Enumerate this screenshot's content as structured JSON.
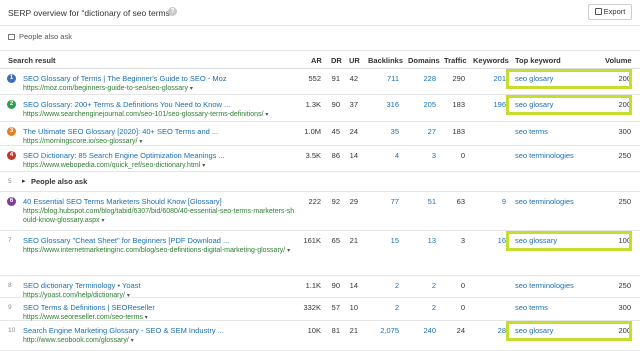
{
  "header": {
    "title": "SERP overview for “dictionary of seo terms”",
    "help_icon": "?",
    "export_label": "Export",
    "people_also_ask_label": "People also ask"
  },
  "columns": {
    "result": "Search result",
    "ar": "AR",
    "dr": "DR",
    "ur": "UR",
    "backlinks": "Backlinks",
    "domains": "Domains",
    "traffic": "Traffic",
    "keywords": "Keywords",
    "top_keyword": "Top keyword",
    "volume": "Volume"
  },
  "colors": {
    "highlight": "#c6dc2f",
    "link": "#1a6fb5",
    "url": "#2e7d32"
  },
  "rows": [
    {
      "rank": "1",
      "badge_color": "#3b6fb6",
      "title": "SEO Glossary of Terms | The Beginner's Guide to SEO - Moz",
      "url": "https://moz.com/beginners-guide-to-seo/seo-glossary",
      "ar": "552",
      "dr": "91",
      "ur": "42",
      "backlinks": "711",
      "domains": "228",
      "traffic": "290",
      "keywords": "201",
      "top_keyword": "seo glosary",
      "volume": "200",
      "highlight": true
    },
    {
      "rank": "2",
      "badge_color": "#2e9d4c",
      "title": "SEO Glossary: 200+ Terms & Definitions You Need to Know ...",
      "url": "https://www.searchenginejournal.com/seo-101/seo-glossary-terms-definitions/",
      "ar": "1.3K",
      "dr": "90",
      "ur": "37",
      "backlinks": "316",
      "domains": "205",
      "traffic": "183",
      "keywords": "196",
      "top_keyword": "seo glosary",
      "volume": "200",
      "highlight": true
    },
    {
      "rank": "3",
      "badge_color": "#e67e22",
      "title": "The Ultimate SEO Glossary [2020]: 40+ SEO Terms and ...",
      "url": "https://morningscore.io/seo-glossary/",
      "ar": "1.0M",
      "dr": "45",
      "ur": "24",
      "backlinks": "35",
      "domains": "27",
      "traffic": "183",
      "keywords": "",
      "top_keyword": "seo terms",
      "volume": "300",
      "highlight": false
    },
    {
      "rank": "4",
      "badge_color": "#c0392b",
      "title": "SEO Dictionary: 85 Search Engine Optimization Meanings ...",
      "url": "https://www.webopedia.com/quick_ref/seo-dictionary.html",
      "ar": "3.5K",
      "dr": "86",
      "ur": "14",
      "backlinks": "4",
      "domains": "3",
      "traffic": "0",
      "keywords": "",
      "top_keyword": "seo terminologies",
      "volume": "250",
      "highlight": false
    },
    {
      "rank": "6",
      "badge_color": "#7d3c98",
      "title": "40 Essential SEO Terms Marketers Should Know [Glossary]",
      "url": "https://blog.hubspot.com/blog/tabid/6307/bid/6080/40-essential-seo-terms-marketers-should-know-glossary.aspx",
      "ar": "222",
      "dr": "92",
      "ur": "29",
      "backlinks": "77",
      "domains": "51",
      "traffic": "63",
      "keywords": "9",
      "top_keyword": "seo terminologies",
      "volume": "250",
      "highlight": false
    },
    {
      "rank": "7",
      "badge_color": "",
      "title": "SEO Glossary \"Cheat Sheet\" for Beginners [PDF Download ...",
      "url": "https://www.internetmarketinginc.com/blog/seo-definitions-digital-marketing-glossary/",
      "ar": "161K",
      "dr": "65",
      "ur": "21",
      "backlinks": "15",
      "domains": "13",
      "traffic": "3",
      "keywords": "16",
      "top_keyword": "seo glossary",
      "volume": "100",
      "highlight": true
    },
    {
      "rank": "8",
      "badge_color": "",
      "title": "SEO dictionary Terminology • Yoast",
      "url": "https://yoast.com/help/dictionary/",
      "ar": "1.1K",
      "dr": "90",
      "ur": "14",
      "backlinks": "2",
      "domains": "2",
      "traffic": "0",
      "keywords": "",
      "top_keyword": "seo terminologies",
      "volume": "250",
      "highlight": false
    },
    {
      "rank": "9",
      "badge_color": "",
      "title": "SEO Terms & Definitions | SEOReseller",
      "url": "https://www.seoreseller.com/seo-terms",
      "ar": "332K",
      "dr": "57",
      "ur": "10",
      "backlinks": "2",
      "domains": "2",
      "traffic": "0",
      "keywords": "",
      "top_keyword": "seo terms",
      "volume": "300",
      "highlight": false
    },
    {
      "rank": "10",
      "badge_color": "",
      "title": "Search Engine Marketing Glossary - SEO & SEM Industry ...",
      "url": "http://www.seobook.com/glossary/",
      "ar": "10K",
      "dr": "81",
      "ur": "21",
      "backlinks": "2,075",
      "domains": "240",
      "traffic": "24",
      "keywords": "28",
      "top_keyword": "seo glosary",
      "volume": "200",
      "highlight": true
    }
  ],
  "paa_row": {
    "rank": "5",
    "label": "People also ask"
  }
}
